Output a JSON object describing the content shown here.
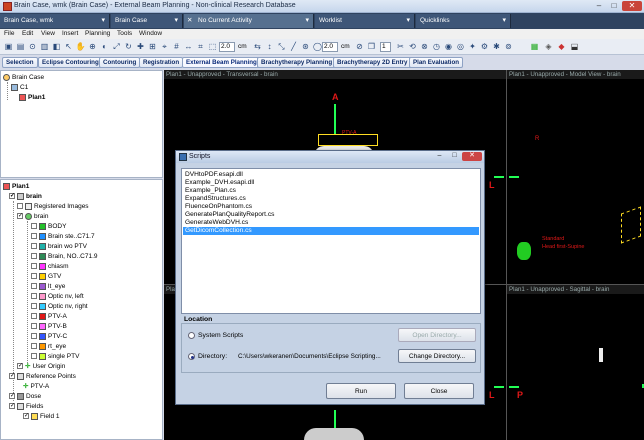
{
  "window_title": "Brain Case, wmk (Brain Case) - External Beam Planning - Non-clinical Research Database",
  "context_tabs": [
    {
      "label": "Brain Case, wmk"
    },
    {
      "label": "Brain Case"
    },
    {
      "label": "No Current Activity"
    },
    {
      "label": "Worklist"
    },
    {
      "label": "Quicklinks"
    }
  ],
  "menu": [
    "File",
    "Edit",
    "View",
    "Insert",
    "Planning",
    "Tools",
    "Window"
  ],
  "toolbar": {
    "field1": "2.0",
    "unit1": "cm",
    "field2": "2.0",
    "unit2": "cm",
    "field3": "1"
  },
  "workspaces": [
    "Selection",
    "Eclipse Contouring",
    "Contouring",
    "Registration",
    "External Beam Planning",
    "Brachytherapy Planning",
    "Brachytherapy 2D Entry",
    "Plan Evaluation"
  ],
  "top_tree": {
    "root": "Brain Case",
    "course": "C1",
    "plan": "Plan1"
  },
  "structure_tree": {
    "root": "Plan1",
    "image": "brain",
    "registered": "Registered Images",
    "structure_set": "brain",
    "structures": [
      {
        "name": "BODY",
        "color": "#24c02a"
      },
      {
        "name": "Brain ste..C71.7",
        "color": "#1e90ff"
      },
      {
        "name": "brain wo PTV",
        "color": "#20b2aa"
      },
      {
        "name": "Brain, NO..C71.9",
        "color": "#2e8b57"
      },
      {
        "name": "chiasm",
        "color": "#ff33ff"
      },
      {
        "name": "GTV",
        "color": "#ffd000"
      },
      {
        "name": "lt_eye",
        "color": "#9b59d0"
      },
      {
        "name": "Optic nv, left",
        "color": "#ff99cc"
      },
      {
        "name": "Optic nv, right",
        "color": "#33ccff"
      },
      {
        "name": "PTV-A",
        "color": "#e01818"
      },
      {
        "name": "PTV-B",
        "color": "#ff66ff"
      },
      {
        "name": "PTV-C",
        "color": "#3355ff"
      },
      {
        "name": "rt_eye",
        "color": "#ff9900"
      },
      {
        "name": "single PTV",
        "color": "#ccff33"
      }
    ],
    "user_origin": "User Origin",
    "reference_points": "Reference Points",
    "ref_point": "PTV-A",
    "dose": "Dose",
    "fields": "Fields",
    "field1": "Field 1"
  },
  "views": {
    "transversal": "Plan1 - Unapproved - Transversal - brain",
    "model": "Plan1 - Unapproved - Model View - brain",
    "sagittal": "Plan1 - Unapproved - Sagittal - brain",
    "bottom_left": "Plan1",
    "orient_a": "A",
    "orient_l": "L",
    "orient_l2": "L",
    "orient_p": "P",
    "orient_r": "R",
    "ptv_label": "PTV-A",
    "model_label_1": "Standard",
    "model_label_2": "Head first-Supine"
  },
  "dialog": {
    "title": "Scripts",
    "scripts": [
      "DVHtoPDF.esapi.dll",
      "Example_DVH.esapi.dll",
      "Example_Plan.cs",
      "ExpandStructures.cs",
      "FluenceOnPhantom.cs",
      "GeneratePlanQualityReport.cs",
      "GenerateWebDVH.cs",
      "GetDicomCollection.cs"
    ],
    "selected_index": 7,
    "location_label": "Location",
    "system_scripts": "System Scripts",
    "directory_label": "Directory:",
    "directory_path": "C:\\Users\\wkeranen\\Documents\\Eclipse Scripting...",
    "open_directory": "Open Directory...",
    "change_directory": "Change Directory...",
    "run": "Run",
    "close": "Close"
  }
}
